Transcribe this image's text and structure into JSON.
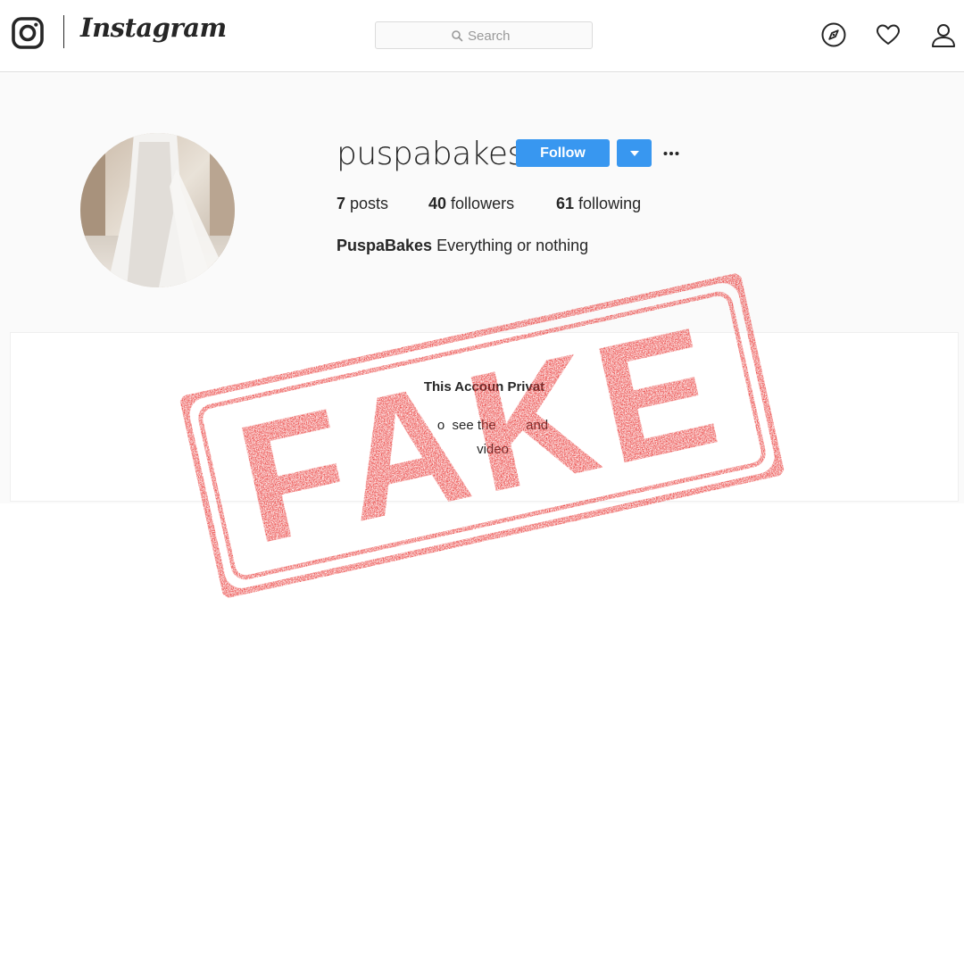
{
  "nav": {
    "brand": "Instagram",
    "search_placeholder": "Search",
    "icons": [
      "instagram-glyph-icon",
      "compass-icon",
      "heart-icon",
      "person-icon"
    ]
  },
  "profile": {
    "username": "puspabakes",
    "follow_label": "Follow",
    "posts_count": "7",
    "posts_label": "posts",
    "followers_count": "40",
    "followers_label": "followers",
    "following_count": "61",
    "following_label": "following",
    "full_name": "PuspaBakes",
    "bio": "Everything or nothing"
  },
  "private_notice": {
    "title": "This Accoun   Privat",
    "line1": "o  see the        and",
    "line2": "video"
  },
  "stamp": {
    "text": "FAKE",
    "color": "#e8312f"
  },
  "colors": {
    "accent": "#3897f0",
    "border": "#dbdbdb",
    "band": "#fafafa"
  }
}
